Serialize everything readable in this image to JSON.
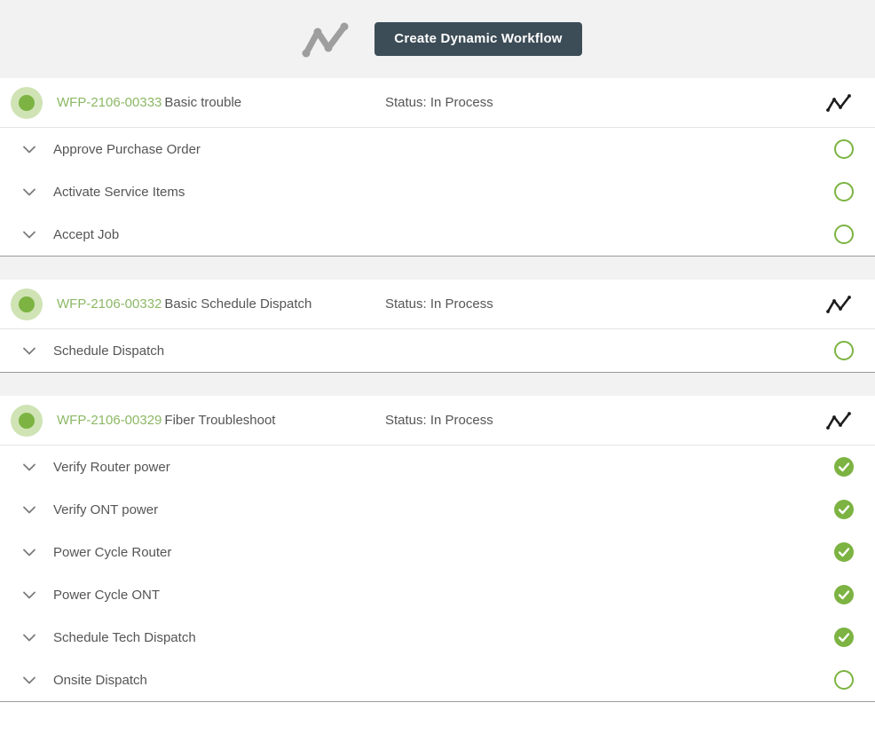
{
  "toolbar": {
    "brand_icon": "line-chart-zigzag-icon",
    "create_button_label": "Create Dynamic Workflow"
  },
  "colors": {
    "accent_green": "#7cb342",
    "link_green": "#8cb865",
    "dot_halo": "#cfe3b4",
    "button_bg": "#3d4d57",
    "page_bg": "#f2f2f2",
    "text": "#555555"
  },
  "status_labels": {
    "open": "not-started",
    "done": "completed"
  },
  "workflows": [
    {
      "id": "WFP-2106-00333",
      "name": "Basic trouble",
      "status": "Status: In Process",
      "indicator": "in-process",
      "chart_icon": "trend-chart-icon",
      "tasks": [
        {
          "label": "Approve Purchase Order",
          "state": "open"
        },
        {
          "label": "Activate Service Items",
          "state": "open"
        },
        {
          "label": "Accept Job",
          "state": "open"
        }
      ]
    },
    {
      "id": "WFP-2106-00332",
      "name": "Basic Schedule Dispatch",
      "status": "Status: In Process",
      "indicator": "in-process",
      "chart_icon": "trend-chart-icon",
      "tasks": [
        {
          "label": "Schedule Dispatch",
          "state": "open"
        }
      ]
    },
    {
      "id": "WFP-2106-00329",
      "name": "Fiber Troubleshoot",
      "status": "Status: In Process",
      "indicator": "in-process",
      "chart_icon": "trend-chart-icon",
      "tasks": [
        {
          "label": "Verify Router power",
          "state": "done"
        },
        {
          "label": "Verify ONT power",
          "state": "done"
        },
        {
          "label": "Power Cycle Router",
          "state": "done"
        },
        {
          "label": "Power Cycle ONT",
          "state": "done"
        },
        {
          "label": "Schedule Tech Dispatch",
          "state": "done"
        },
        {
          "label": "Onsite Dispatch",
          "state": "open"
        }
      ]
    }
  ]
}
